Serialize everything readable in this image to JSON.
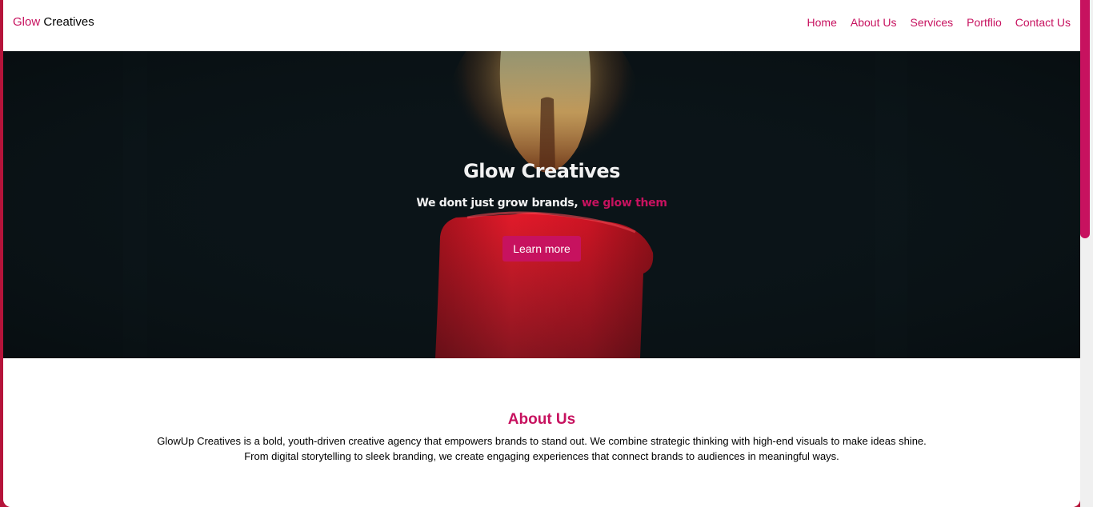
{
  "navbar": {
    "brand_accent": "Glow",
    "brand_rest": " Creatives",
    "links": [
      "Home",
      "About Us",
      "Services",
      "Portflio",
      "Contact Us"
    ]
  },
  "hero": {
    "title": "Glow Creatives",
    "tagline_main": "We dont just grow brands, ",
    "tagline_accent": "we glow them",
    "button_label": "Learn more"
  },
  "about": {
    "title": "About Us",
    "line1": "GlowUp Creatives is a bold, youth-driven creative agency that empowers brands to stand out. We combine strategic thinking with high-end visuals to make ideas shine.",
    "line2": "From digital storytelling to sleek branding, we create engaging experiences that connect brands to audiences in meaningful ways."
  },
  "colors": {
    "accent": "#c7125f",
    "frame": "#b5143a",
    "hero_bg": "#0a1216"
  }
}
